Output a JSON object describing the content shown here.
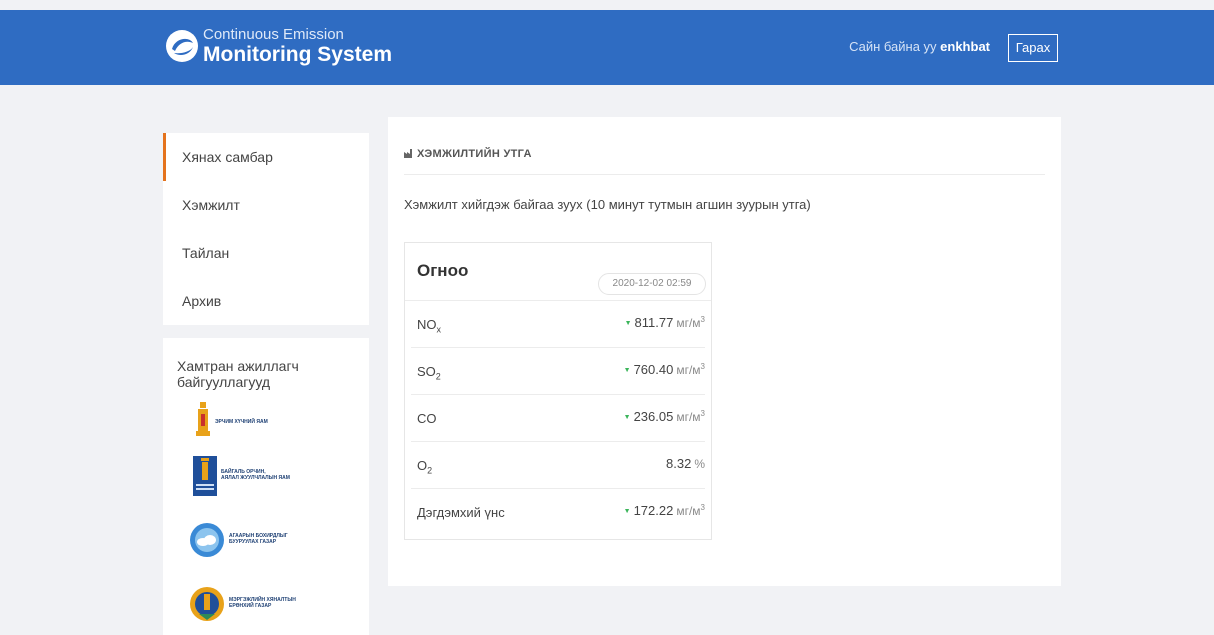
{
  "header": {
    "logo_line1": "Continuous Emission",
    "logo_line2": "Monitoring System",
    "greeting_prefix": "Сайн байна уу ",
    "username": "enkhbat",
    "logout_label": "Гарах",
    "bg_color": "#2f6cc2"
  },
  "sidebar": {
    "items": [
      {
        "label": "Хянах самбар",
        "active": true
      },
      {
        "label": "Хэмжилт"
      },
      {
        "label": "Тайлан"
      },
      {
        "label": "Архив"
      }
    ],
    "active_accent": "#e4731d",
    "partners_title": "Хамтран ажиллагч байгууллагууд",
    "partners": [
      {
        "name_line1": "ЭРЧИМ ХҮЧНИЙ ЯАМ",
        "name_line2": "",
        "icon": "soyombo-emblem-icon"
      },
      {
        "name_line1": "БАЙГАЛЬ ОРЧИН,",
        "name_line2": "АЯЛАЛ ЖУУЛЧЛАЛЫН ЯАМ",
        "icon": "ministry-emblem-icon"
      },
      {
        "name_line1": "АГААРЫН БОХИРДЛЫГ",
        "name_line2": "БУУРУУЛАХ ГАЗАР",
        "icon": "air-agency-logo-icon"
      },
      {
        "name_line1": "МЭРГЭЖЛИЙН ХЯНАЛТЫН",
        "name_line2": "ЕРӨНХИЙ ГАЗАР",
        "icon": "inspection-agency-logo-icon"
      }
    ]
  },
  "panel": {
    "title": "ХЭМЖИЛТИЙН УТГА",
    "title_icon": "factory-icon",
    "description": "Хэмжилт хийгдэж байгаа зуух (10 минут тутмын агшин зуурын утга)",
    "card": {
      "title": "Огноо",
      "date": "2020-12-02 02:59",
      "measurements": [
        {
          "name": "NO",
          "sub": "x",
          "value": "811.77",
          "unit": "мг/м",
          "unit_sup": "3",
          "trend": "down"
        },
        {
          "name": "SO",
          "sub": "2",
          "value": "760.40",
          "unit": "мг/м",
          "unit_sup": "3",
          "trend": "down"
        },
        {
          "name": "CO",
          "sub": "",
          "value": "236.05",
          "unit": "мг/м",
          "unit_sup": "3",
          "trend": "down"
        },
        {
          "name": "O",
          "sub": "2",
          "value": "8.32",
          "unit": "%",
          "unit_sup": "",
          "trend": "none"
        },
        {
          "name": "Дэгдэмхий үнс",
          "sub": "",
          "value": "172.22",
          "unit": "мг/м",
          "unit_sup": "3",
          "trend": "down"
        }
      ],
      "trend_color": "#3bb55b"
    }
  }
}
